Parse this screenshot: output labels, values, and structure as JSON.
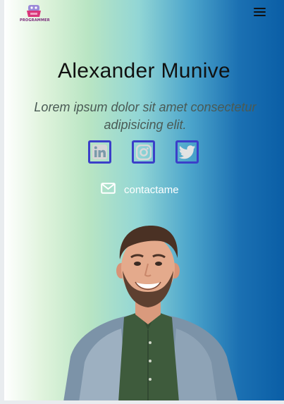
{
  "brand": {
    "logo_text": "PROGRAMMER"
  },
  "hero": {
    "name": "Alexander Munive",
    "tagline": "Lorem ipsum dolor sit amet consectetur adipisicing elit."
  },
  "social": [
    {
      "name": "linkedin",
      "icon": "linkedin-icon"
    },
    {
      "name": "instagram",
      "icon": "instagram-icon"
    },
    {
      "name": "twitter",
      "icon": "twitter-icon"
    }
  ],
  "contact": {
    "label": "contactame",
    "icon": "mail-icon"
  },
  "colors": {
    "icon_border": "#3b3fc9",
    "gradient_left": "#ffffff",
    "gradient_mid": "#92d6d5",
    "gradient_right": "#0a5ea6"
  }
}
